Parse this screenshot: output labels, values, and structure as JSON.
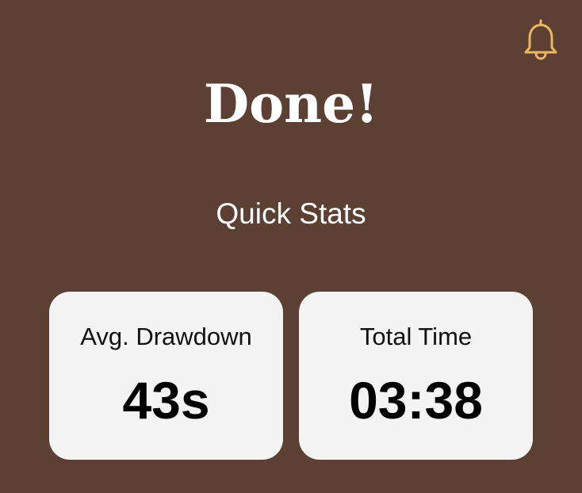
{
  "colors": {
    "background": "#5c4033",
    "accent": "#e9b75f",
    "card": "#f4f4f4",
    "title_text": "#ffffff"
  },
  "header": {
    "notification_icon": "bell-icon",
    "title": "Done!"
  },
  "quick_stats": {
    "heading": "Quick Stats",
    "cards": [
      {
        "label": "Avg. Drawdown",
        "value": "43s"
      },
      {
        "label": "Total Time",
        "value": "03:38"
      }
    ]
  }
}
